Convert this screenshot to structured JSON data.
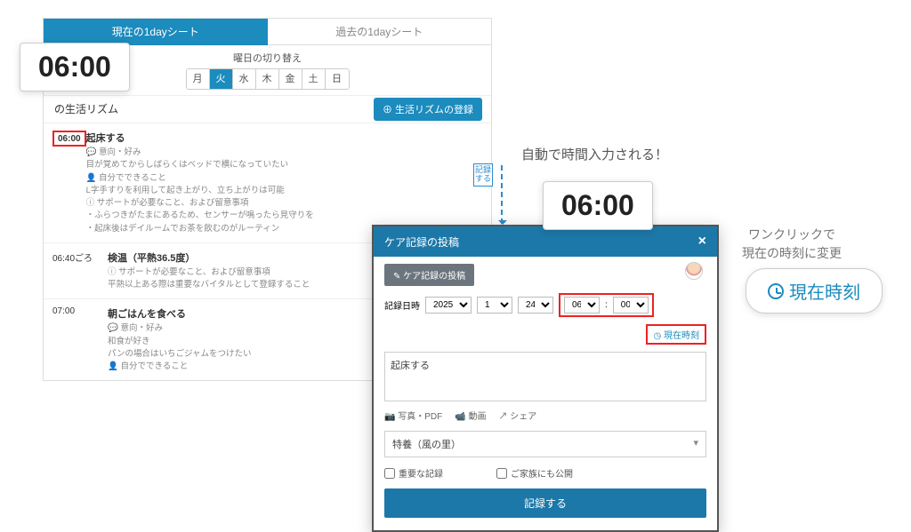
{
  "tabs": {
    "current": "現在の1dayシート",
    "past": "過去の1dayシート"
  },
  "day_switch": {
    "label": "曜日の切り替え",
    "days": [
      "月",
      "火",
      "水",
      "木",
      "金",
      "土",
      "日"
    ],
    "active_index": 1
  },
  "section": {
    "title": "の生活リズム",
    "register": "生活リズムの登録"
  },
  "entries": [
    {
      "time": "06:00",
      "title": "起床する",
      "lines": [
        "💬 意向・好み",
        "目が覚めてからしばらくはベッドで横になっていたい",
        "👤 自分でできること",
        "L字手すりを利用して起き上がり、立ち上がりは可能",
        "ⓘ サポートが必要なこと、および留意事項",
        "・ふらつきがたまにあるため、センサーが鳴ったら見守りを",
        "・起床後はデイルームでお茶を飲むのがルーティン"
      ]
    },
    {
      "time": "06:40ごろ",
      "title": "検温（平熱36.5度）",
      "lines": [
        "ⓘ サポートが必要なこと、および留意事項",
        "平熱以上ある際は重要なバイタルとして登録すること"
      ]
    },
    {
      "time": "07:00",
      "title": "朝ごはんを食べる",
      "lines": [
        "💬 意向・好み",
        "和食が好き",
        "パンの場合はいちごジャムをつけたい",
        "👤 自分でできること"
      ]
    }
  ],
  "record_tag": "記録する",
  "callout_time": "06:00",
  "anno1": "自動で時間入力される！",
  "anno2_l1": "ワンクリックで",
  "anno2_l2": "現在の時刻に変更",
  "now_pill": "現在時刻",
  "modal": {
    "title": "ケア記録の投稿",
    "sub": "ケア記録の投稿",
    "date_label": "記録日時",
    "year": "2025",
    "month": "1",
    "day": "24",
    "hour": "06",
    "minute": "00",
    "now_link": "現在時刻",
    "textarea_value": "起床する",
    "attach_photo": "📷 写真・PDF",
    "attach_video": "📹 動画",
    "attach_share": "↗ シェア",
    "facility": "特養（風の里）",
    "chk_important": "重要な記録",
    "chk_family": "ご家族にも公開",
    "submit": "記録する"
  }
}
